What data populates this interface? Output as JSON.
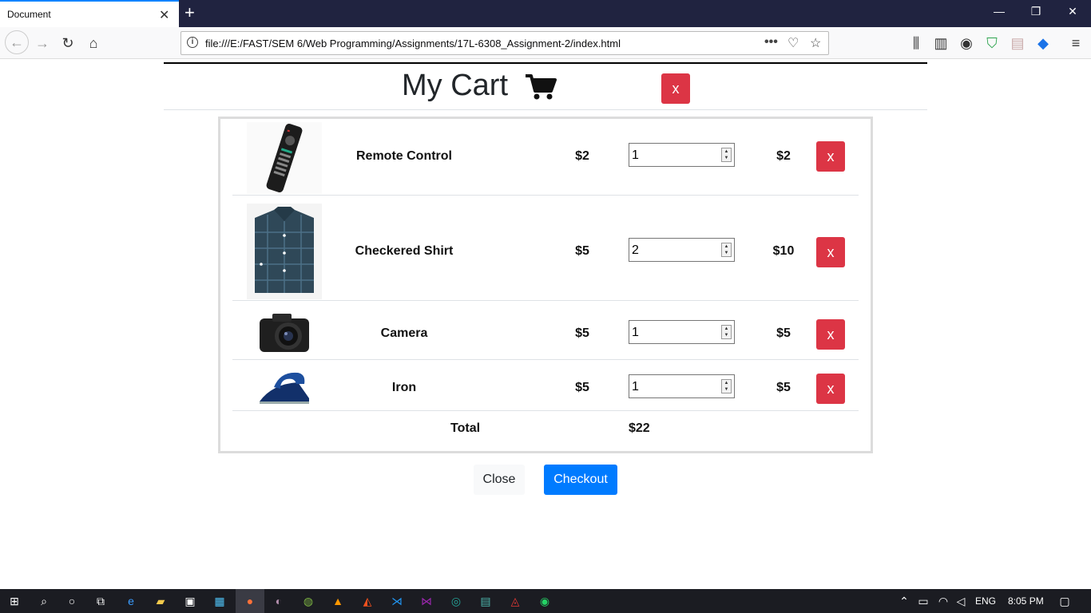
{
  "browser": {
    "tab_title": "Document",
    "url": "file:///E:/FAST/SEM 6/Web Programming/Assignments/17L-6308_Assignment-2/index.html",
    "url_menu": "•••"
  },
  "cart": {
    "title": "My Cart",
    "close_x": "x",
    "items": [
      {
        "name": "Remote Control",
        "price": "$2",
        "qty": "1",
        "subtotal": "$2",
        "remove": "x"
      },
      {
        "name": "Checkered Shirt",
        "price": "$5",
        "qty": "2",
        "subtotal": "$10",
        "remove": "x"
      },
      {
        "name": "Camera",
        "price": "$5",
        "qty": "1",
        "subtotal": "$5",
        "remove": "x"
      },
      {
        "name": "Iron",
        "price": "$5",
        "qty": "1",
        "subtotal": "$5",
        "remove": "x"
      }
    ],
    "total_label": "Total",
    "total_value": "$22",
    "close_button": "Close",
    "checkout_button": "Checkout"
  },
  "taskbar": {
    "language": "ENG",
    "time": "8:05 PM"
  }
}
